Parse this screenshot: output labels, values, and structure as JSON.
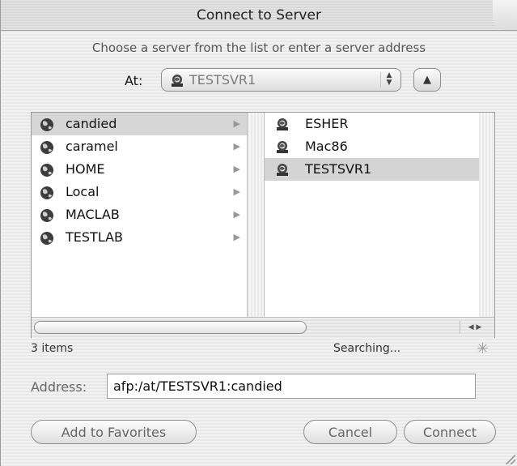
{
  "window": {
    "title": "Connect to Server"
  },
  "subtitle": "Choose a server from the list or enter a server address",
  "location": {
    "label": "At:",
    "value": "TESTSVR1"
  },
  "browser": {
    "column1": [
      {
        "label": "candied",
        "selected": true
      },
      {
        "label": "caramel"
      },
      {
        "label": "HOME"
      },
      {
        "label": "Local"
      },
      {
        "label": "MACLAB"
      },
      {
        "label": "TESTLAB"
      }
    ],
    "column2": [
      {
        "label": "ESHER"
      },
      {
        "label": "Mac86"
      },
      {
        "label": "TESTSVR1",
        "selected": true
      }
    ]
  },
  "status": {
    "items": "3 items",
    "state": "Searching..."
  },
  "address": {
    "label": "Address:",
    "value": "afp:/at/TESTSVR1:candied"
  },
  "buttons": {
    "add_favorites": "Add to Favorites",
    "cancel": "Cancel",
    "connect": "Connect"
  },
  "icons": {
    "zone": "globe-icon",
    "server": "server-icon",
    "spinner": "spinner-icon"
  }
}
